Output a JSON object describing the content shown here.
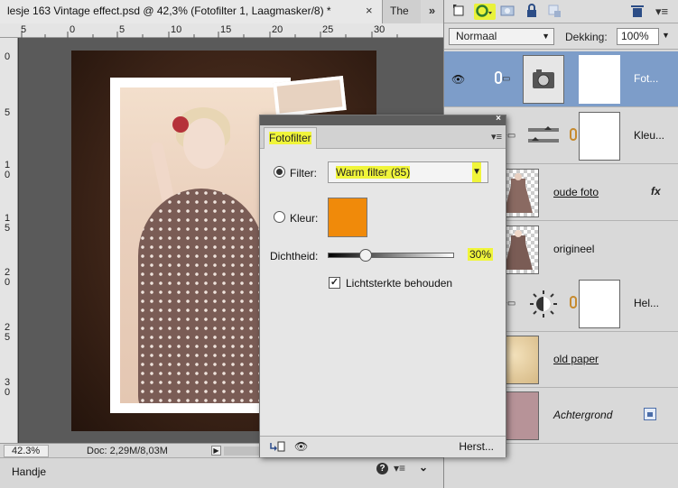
{
  "document_tabs": [
    {
      "label": "lesje 163 Vintage effect.psd @ 42,3% (Fotofilter 1, Laagmasker/8) *",
      "active": true
    },
    {
      "label": "The",
      "active": false
    }
  ],
  "tab_overflow_label": "»",
  "tab_close_label": "×",
  "ruler_top_ticks": [
    "5",
    "0",
    "5",
    "10",
    "15",
    "20",
    "25",
    "30"
  ],
  "ruler_left_ticks": [
    "0",
    "5",
    "10",
    "15",
    "20",
    "25",
    "30"
  ],
  "status": {
    "zoom": "42.3%",
    "doc": "Doc: 2,29M/8,03M"
  },
  "bottom_panel": {
    "tool_name": "Handje"
  },
  "layers_panel": {
    "blend_mode": "Normaal",
    "opacity_label": "Dekking:",
    "opacity_value": "100%",
    "layers": [
      {
        "name": "Fot...",
        "selected": true,
        "style": "normal"
      },
      {
        "name": "Kleu...",
        "selected": false,
        "style": "normal"
      },
      {
        "name": "oude foto",
        "selected": false,
        "style": "underlined",
        "fx": "fx"
      },
      {
        "name": "origineel",
        "selected": false,
        "style": "normal"
      },
      {
        "name": "Hel...",
        "selected": false,
        "style": "normal"
      },
      {
        "name": "old paper",
        "selected": false,
        "style": "underlined"
      },
      {
        "name": "Achtergrond",
        "selected": false,
        "style": "italic"
      }
    ]
  },
  "dialog": {
    "tab_label": "Fotofilter",
    "filter_label": "Filter:",
    "filter_value": "Warm filter (85)",
    "color_label": "Kleur:",
    "color_value": "#f08a0a",
    "density_label": "Dichtheid:",
    "density_value": "30%",
    "density_fraction": 0.3,
    "preserve_luminosity_label": "Lichtsterkte behouden",
    "preserve_luminosity_checked": true,
    "reset_label": "Herst..."
  },
  "colors": {
    "highlight": "#f0f53a",
    "selected_layer": "#7d9dc9",
    "canvas_bg": "#5a5a5a"
  }
}
